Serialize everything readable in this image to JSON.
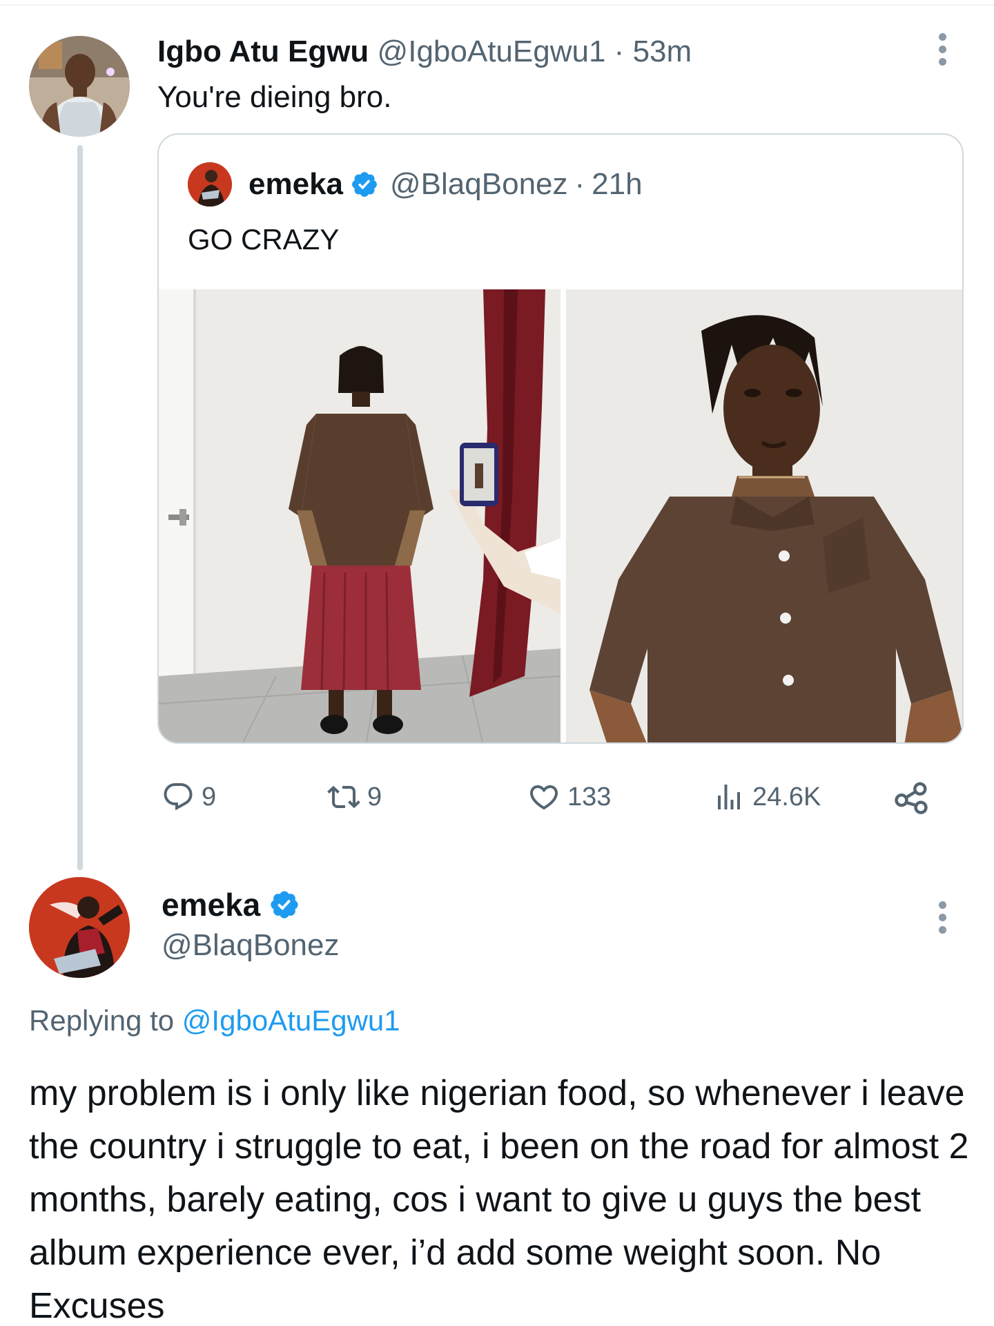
{
  "parent_tweet": {
    "author_name": "Igbo Atu Egwu",
    "author_handle": "@IgboAtuEgwu1",
    "separator": "·",
    "timestamp": "53m",
    "text": "You're dieing bro."
  },
  "quoted_tweet": {
    "author_name": "emeka",
    "author_handle": "@BlaqBonez",
    "separator": "·",
    "timestamp": "21h",
    "text": "GO CRAZY"
  },
  "actions": {
    "replies": "9",
    "retweets": "9",
    "likes": "133",
    "views": "24.6K"
  },
  "reply_tweet": {
    "author_name": "emeka",
    "author_handle": "@BlaqBonez",
    "replying_label": "Replying to",
    "replying_to_handle": "@IgboAtuEgwu1",
    "text": "my problem is i only like nigerian food, so whenever i leave the country i struggle to eat, i been on the road for almost 2 months, barely eating, cos i want to give u guys the best album experience ever, i’d add some weight soon. No Excuses"
  },
  "colors": {
    "text_primary": "#0f1419",
    "text_secondary": "#536471",
    "link": "#1d9bf0",
    "verified": "#1d9bf0",
    "border": "#cfd9de"
  },
  "icons": {
    "more": "more-icon",
    "verified": "verified-badge-icon",
    "reply": "reply-icon",
    "retweet": "retweet-icon",
    "like": "heart-icon",
    "views": "views-icon",
    "share": "share-icon"
  }
}
